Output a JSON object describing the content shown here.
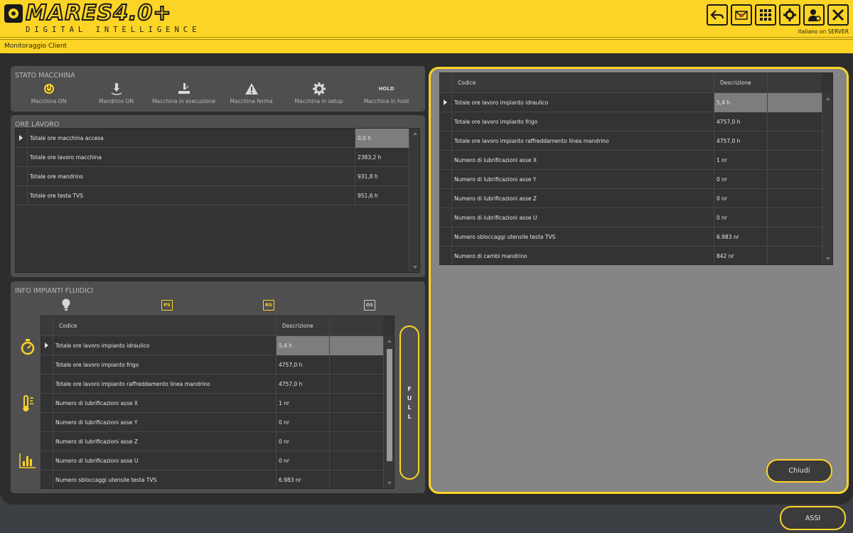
{
  "app": {
    "logo_text": "MARES4.0+",
    "logo_subtitle": "DIGITAL INTELLIGENCE",
    "language": "italiano on SERVER",
    "breadcrumb": "Monitoraggio Client"
  },
  "toolbar": {
    "icons": [
      "back-icon",
      "mail-alert-icon",
      "grid-icon",
      "settings-icon",
      "user-settings-icon",
      "close-icon"
    ]
  },
  "stato": {
    "title": "STATO MACCHINA",
    "items": [
      {
        "icon": "power-icon",
        "label": "Macchina ON",
        "color": "#fcd425"
      },
      {
        "icon": "spindle-icon",
        "label": "Mandrino ON"
      },
      {
        "icon": "machining-icon",
        "label": "Macchina in esecuzione"
      },
      {
        "icon": "warning-icon",
        "label": "Macchina ferma"
      },
      {
        "icon": "gear-icon",
        "label": "Macchina in setup"
      },
      {
        "icon": "hold-text",
        "label": "Macchina in hold",
        "text": "HOLD"
      }
    ]
  },
  "ore": {
    "title": "ORE LAVORO",
    "rows": [
      {
        "label": "Totale ore macchina accesa",
        "value": "0,0 h"
      },
      {
        "label": "Totale ore lavoro macchina",
        "value": "2383,2 h"
      },
      {
        "label": "Totale ore mandrino",
        "value": "931,8 h"
      },
      {
        "label": "Totale ore testa TVS",
        "value": "951,6 h"
      }
    ]
  },
  "fluidici": {
    "title": "INFO IMPIANTI FLUIDICI",
    "tabs": [
      {
        "icon": "bulb-icon"
      },
      {
        "icon": "ps-badge",
        "text": "PS"
      },
      {
        "icon": "rs-badge",
        "text": "RS"
      },
      {
        "icon": "os-badge",
        "text": "OS"
      }
    ],
    "side_icons": [
      "stopwatch-icon",
      "thermometer-icon",
      "chart-icon"
    ],
    "headers": {
      "codice": "Codice",
      "descrizione": "Descrizione"
    },
    "rows": [
      {
        "label": "Totale ore lavoro impianto idraulico",
        "value": "5,4 h"
      },
      {
        "label": "Totale ore lavoro impianto frigo",
        "value": "4757,0 h"
      },
      {
        "label": "Totale ore lavoro impianto raffreddamento linea mandrino",
        "value": "4757,0 h"
      },
      {
        "label": "Numero di lubrificazioni asse X",
        "value": "1 nr"
      },
      {
        "label": "Numero di lubrificazioni asse Y",
        "value": "0 nr"
      },
      {
        "label": "Numero di lubrificazioni asse Z",
        "value": "0 nr"
      },
      {
        "label": "Numero di lubrificazioni asse U",
        "value": "0 nr"
      },
      {
        "label": "Numero sbloccaggi utensile testa TVS",
        "value": "6.983 nr"
      }
    ],
    "full_label": "FULL"
  },
  "popup": {
    "headers": {
      "codice": "Codice",
      "descrizione": "Descrizione"
    },
    "rows": [
      {
        "label": "Totale ore lavoro impianto idraulico",
        "value": "5,4 h"
      },
      {
        "label": "Totale ore lavoro impianto frigo",
        "value": "4757,0 h"
      },
      {
        "label": "Totale ore lavoro impianto raffreddamento linea mandrino",
        "value": "4757,0 h"
      },
      {
        "label": "Numero di lubrificazioni asse X",
        "value": "1 nr"
      },
      {
        "label": "Numero di lubrificazioni asse Y",
        "value": "0 nr"
      },
      {
        "label": "Numero di lubrificazioni asse Z",
        "value": "0 nr"
      },
      {
        "label": "Numero di lubrificazioni asse U",
        "value": "0 nr"
      },
      {
        "label": "Numero sbloccaggi utensile testa TVS",
        "value": "6.983 nr"
      },
      {
        "label": "Numero di cambi mandrino",
        "value": "842 nr"
      }
    ],
    "close_label": "Chiudi"
  },
  "footer": {
    "assi_label": "ASSI"
  },
  "colors": {
    "accent": "#fcd425",
    "panel": "#4f4f4f",
    "grid": "#333333",
    "selected": "#7d7d7d"
  }
}
